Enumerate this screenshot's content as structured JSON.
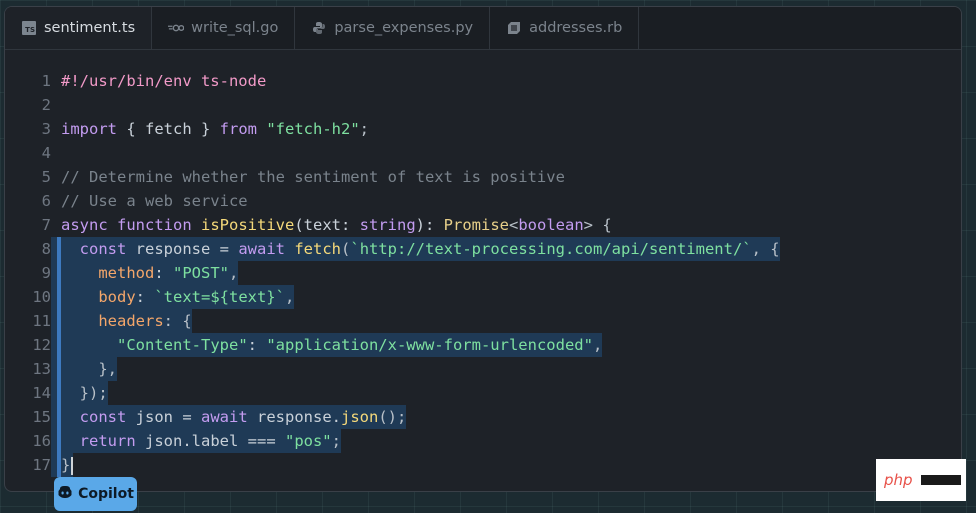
{
  "tabs": [
    {
      "label": "sentiment.ts",
      "icon": "typescript-icon",
      "active": true
    },
    {
      "label": "write_sql.go",
      "icon": "go-icon",
      "active": false
    },
    {
      "label": "parse_expenses.py",
      "icon": "python-icon",
      "active": false
    },
    {
      "label": "addresses.rb",
      "icon": "ruby-icon",
      "active": false
    }
  ],
  "ts_icon_text": "TS",
  "line_numbers": [
    "1",
    "2",
    "3",
    "4",
    "5",
    "6",
    "7",
    "8",
    "9",
    "10",
    "11",
    "12",
    "13",
    "14",
    "15",
    "16",
    "17"
  ],
  "code_lines": [
    [
      [
        "#!/usr/bin/env ts-node",
        "shebang"
      ]
    ],
    [],
    [
      [
        "import",
        "kw"
      ],
      [
        " { fetch } ",
        "plain"
      ],
      [
        "from",
        "kw"
      ],
      [
        " ",
        "plain"
      ],
      [
        "\"fetch-h2\"",
        "str"
      ],
      [
        ";",
        "punc"
      ]
    ],
    [],
    [
      [
        "// Determine whether the sentiment of text is positive",
        "com"
      ]
    ],
    [
      [
        "// Use a web service",
        "com"
      ]
    ],
    [
      [
        "async",
        "kw"
      ],
      [
        " ",
        "plain"
      ],
      [
        "function",
        "kw"
      ],
      [
        " ",
        "plain"
      ],
      [
        "isPositive",
        "fn"
      ],
      [
        "(text: ",
        "plain"
      ],
      [
        "string",
        "kw"
      ],
      [
        "): ",
        "plain"
      ],
      [
        "Promise",
        "type"
      ],
      [
        "<",
        "punc"
      ],
      [
        "boolean",
        "kw"
      ],
      [
        "> {",
        "punc"
      ]
    ],
    [
      [
        "  ",
        "plain"
      ],
      [
        "const",
        "kw"
      ],
      [
        " response = ",
        "plain"
      ],
      [
        "await",
        "kw"
      ],
      [
        " ",
        "plain"
      ],
      [
        "fetch",
        "fn"
      ],
      [
        "(",
        "punc"
      ],
      [
        "`http://text-processing.com/api/sentiment/`",
        "str"
      ],
      [
        ", {",
        "punc"
      ]
    ],
    [
      [
        "    ",
        "plain"
      ],
      [
        "method",
        "prop"
      ],
      [
        ": ",
        "plain"
      ],
      [
        "\"POST\"",
        "str"
      ],
      [
        ",",
        "punc"
      ]
    ],
    [
      [
        "    ",
        "plain"
      ],
      [
        "body",
        "prop"
      ],
      [
        ": ",
        "plain"
      ],
      [
        "`text=${text}`",
        "str"
      ],
      [
        ",",
        "punc"
      ]
    ],
    [
      [
        "    ",
        "plain"
      ],
      [
        "headers",
        "prop"
      ],
      [
        ": {",
        "punc"
      ]
    ],
    [
      [
        "      ",
        "plain"
      ],
      [
        "\"Content-Type\"",
        "str"
      ],
      [
        ": ",
        "plain"
      ],
      [
        "\"application/x-www-form-urlencoded\"",
        "str"
      ],
      [
        ",",
        "punc"
      ]
    ],
    [
      [
        "    },",
        "punc"
      ]
    ],
    [
      [
        "  });",
        "punc"
      ]
    ],
    [
      [
        "  ",
        "plain"
      ],
      [
        "const",
        "kw"
      ],
      [
        " json = ",
        "plain"
      ],
      [
        "await",
        "kw"
      ],
      [
        " response.",
        "plain"
      ],
      [
        "json",
        "fn"
      ],
      [
        "();",
        "punc"
      ]
    ],
    [
      [
        "  ",
        "plain"
      ],
      [
        "return",
        "kw"
      ],
      [
        " json.label === ",
        "plain"
      ],
      [
        "\"pos\"",
        "str"
      ],
      [
        ";",
        "punc"
      ]
    ],
    [
      [
        "}",
        "punc"
      ]
    ]
  ],
  "copilot": {
    "label": "Copilot",
    "icon": "copilot-icon"
  },
  "watermark": {
    "text": "php"
  },
  "colors": {
    "keyword": "#c39cf0",
    "string": "#7ee0a0",
    "comment": "#7a838c",
    "shebang": "#f29ac8",
    "function": "#f5d97a",
    "property": "#f4a66a",
    "highlight": "#1f3a56",
    "copilot_button": "#5aa8e8"
  }
}
